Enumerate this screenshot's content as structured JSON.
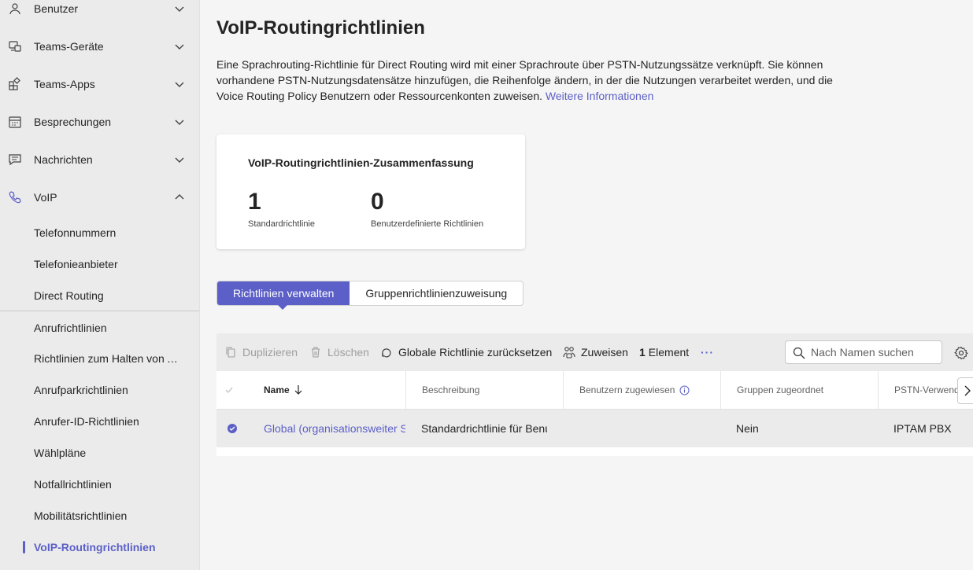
{
  "sidebar": {
    "groups": [
      {
        "label": "Benutzer",
        "icon": "users-icon",
        "expanded": false
      },
      {
        "label": "Teams-Geräte",
        "icon": "devices-icon",
        "expanded": false
      },
      {
        "label": "Teams-Apps",
        "icon": "apps-icon",
        "expanded": false
      },
      {
        "label": "Besprechungen",
        "icon": "calendar-icon",
        "expanded": false
      },
      {
        "label": "Nachrichten",
        "icon": "message-icon",
        "expanded": false
      },
      {
        "label": "VoIP",
        "icon": "phone-icon",
        "expanded": true
      }
    ],
    "voip_items": [
      {
        "label": "Telefonnummern"
      },
      {
        "label": "Telefonieanbieter"
      },
      {
        "label": "Direct Routing"
      },
      {
        "label": "Anrufrichtlinien"
      },
      {
        "label": "Richtlinien zum Halten von Anrufen"
      },
      {
        "label": "Anrufparkrichtlinien"
      },
      {
        "label": "Anrufer-ID-Richtlinien"
      },
      {
        "label": "Wählpläne"
      },
      {
        "label": "Notfallrichtlinien"
      },
      {
        "label": "Mobilitätsrichtlinien"
      },
      {
        "label": "VoIP-Routingrichtlinien",
        "active": true
      }
    ]
  },
  "main": {
    "title": "VoIP-Routingrichtlinien",
    "description": "Eine Sprachrouting-Richtlinie für Direct Routing wird mit einer Sprachroute über PSTN-Nutzungssätze verknüpft. Sie können vorhandene PSTN-Nutzungsdatensätze hinzufügen, die Reihenfolge ändern, in der die Nutzungen verarbeitet werden, und die Voice Routing Policy Benutzern oder Ressourcenkonten zuweisen.",
    "learn_more": "Weitere Informationen",
    "summary": {
      "title": "VoIP-Routingrichtlinien-Zusammenfassung",
      "standard_count": "1",
      "standard_label": "Standardrichtlinie",
      "custom_count": "0",
      "custom_label": "Benutzerdefinierte Richtlinien"
    },
    "tabs": [
      {
        "label": "Richtlinien verwalten",
        "active": true
      },
      {
        "label": "Gruppenrichtlinienzuweisung",
        "active": false
      }
    ],
    "toolbar": {
      "duplicate": "Duplizieren",
      "delete": "Löschen",
      "reset": "Globale Richtlinie zurücksetzen",
      "assign": "Zuweisen",
      "count_num": "1",
      "count_label": "Element",
      "more": "···",
      "search_placeholder": "Nach Namen suchen"
    },
    "table": {
      "columns": [
        "Name",
        "Beschreibung",
        "Benutzern zugewiesen",
        "Gruppen zugeordnet",
        "PSTN-Verwendung"
      ],
      "rows": [
        {
          "name": "Global (organisationsweiter Standard)",
          "description": "Standardrichtlinie für Benutzer",
          "assigned": "",
          "groups": "Nein",
          "pstn": "IPTAM PBX"
        }
      ]
    }
  },
  "colors": {
    "accent": "#5b5fc7",
    "sidebar_bg": "#ebebeb",
    "page_bg": "#f5f5f5"
  }
}
